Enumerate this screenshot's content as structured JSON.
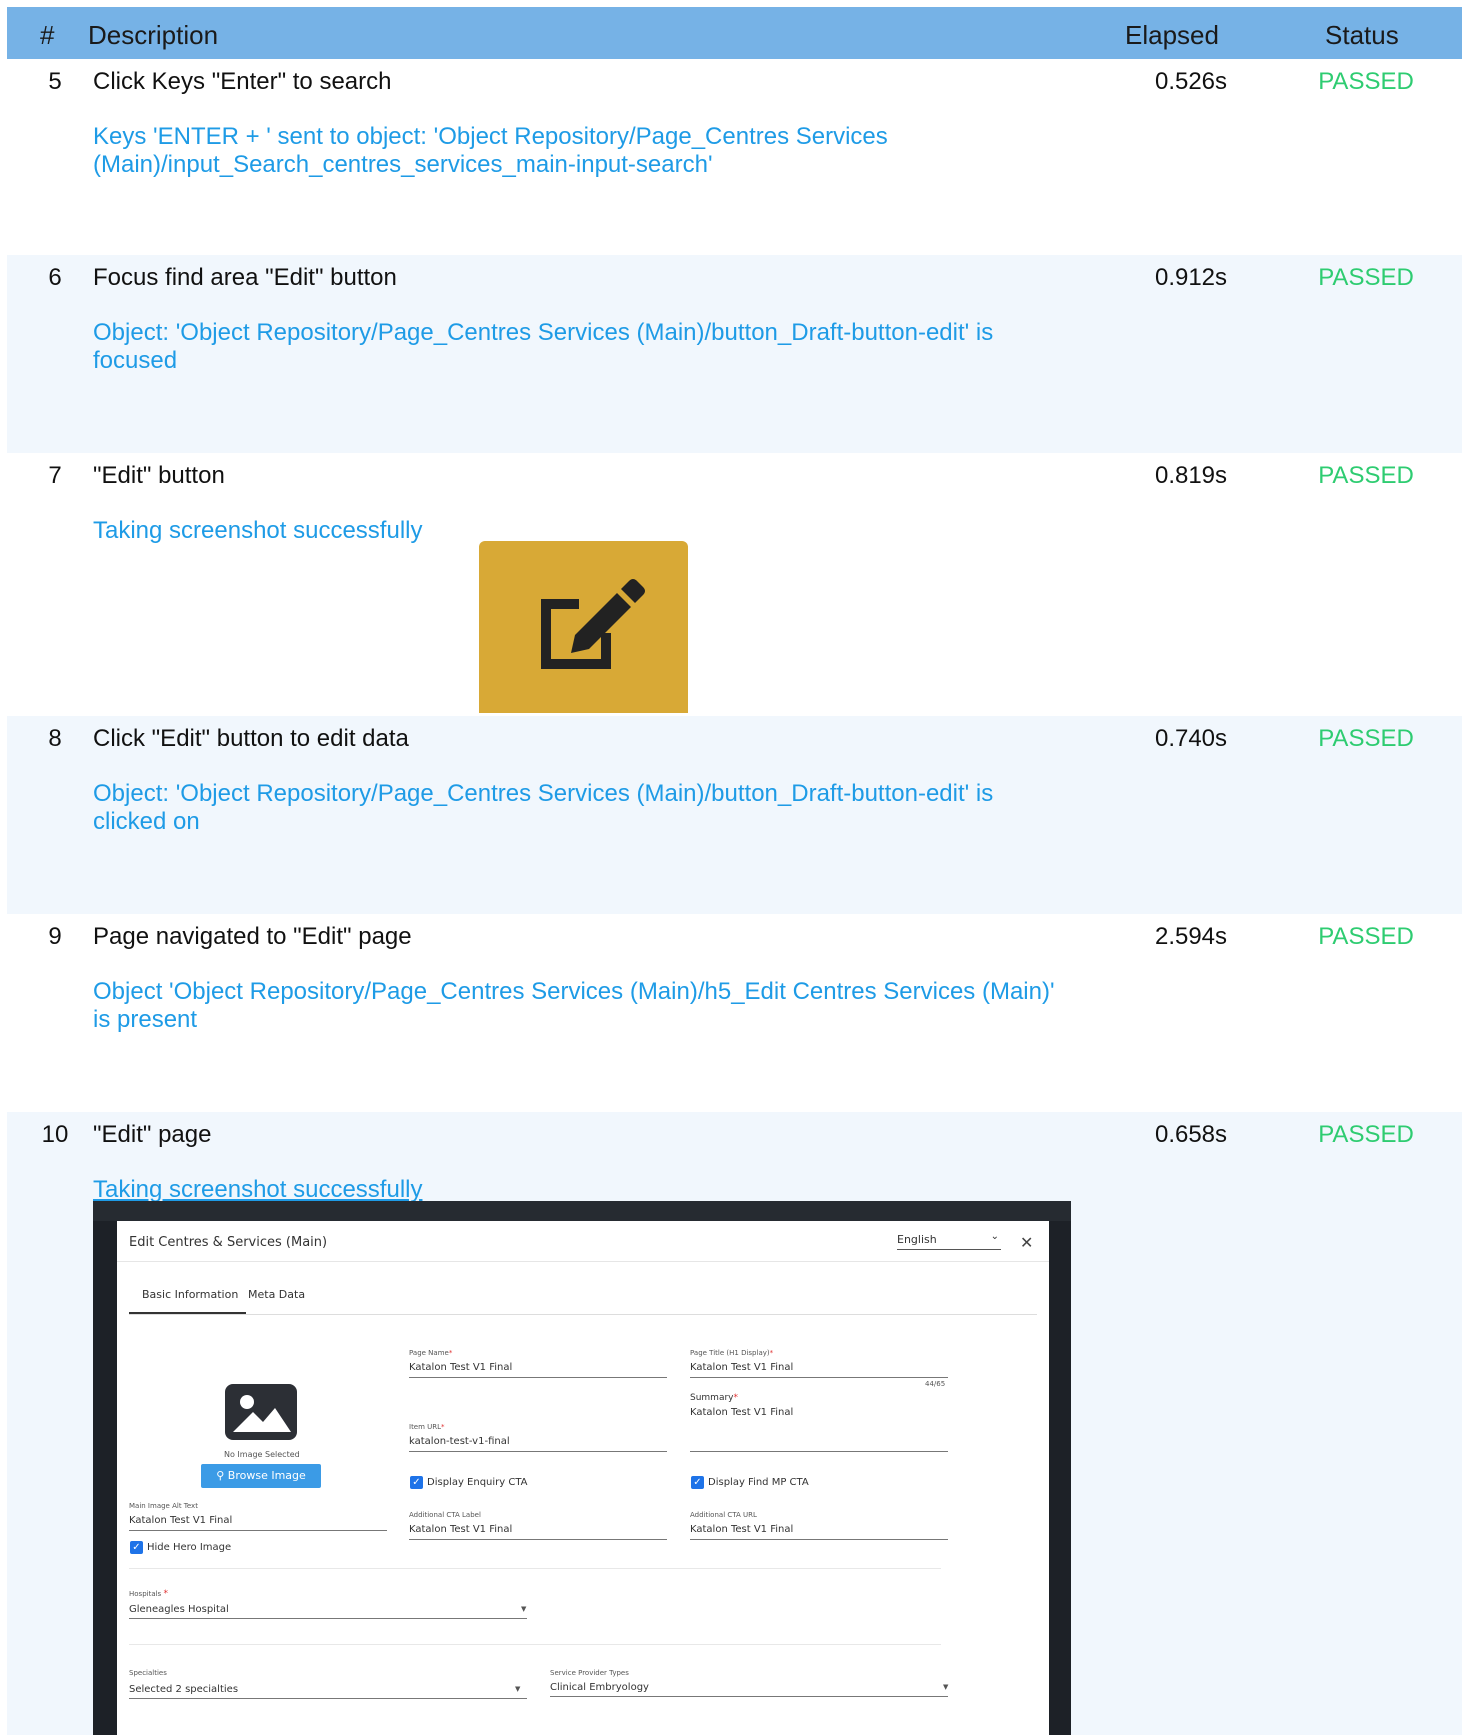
{
  "header": {
    "num": "#",
    "description": "Description",
    "elapsed": "Elapsed",
    "status": "Status"
  },
  "steps": [
    {
      "num": "5",
      "description": "Click Keys \"Enter\" to search",
      "elapsed": "0.526s",
      "status": "PASSED",
      "message_lines": [
        "Keys 'ENTER + ' sent to object: 'Object Repository/Page_Centres  Services",
        "(Main)/input_Search_centres_services_main-input-search'"
      ]
    },
    {
      "num": "6",
      "description": "Focus find area \"Edit\" button",
      "elapsed": "0.912s",
      "status": "PASSED",
      "message_lines": [
        "Object: 'Object Repository/Page_Centres  Services (Main)/button_Draft-button-edit' is",
        "focused"
      ]
    },
    {
      "num": "7",
      "description": "\"Edit\" button",
      "elapsed": "0.819s",
      "status": "PASSED",
      "message_lines": [
        "Taking screenshot successfully"
      ]
    },
    {
      "num": "8",
      "description": "Click \"Edit\" button to edit data",
      "elapsed": "0.740s",
      "status": "PASSED",
      "message_lines": [
        "Object: 'Object Repository/Page_Centres  Services (Main)/button_Draft-button-edit' is",
        "clicked on"
      ]
    },
    {
      "num": "9",
      "description": "Page navigated to \"Edit\" page",
      "elapsed": "2.594s",
      "status": "PASSED",
      "message_lines": [
        "Object 'Object Repository/Page_Centres  Services (Main)/h5_Edit Centres  Services (Main)'",
        "is present"
      ]
    },
    {
      "num": "10",
      "description": "\"Edit\" page",
      "elapsed": "0.658s",
      "status": "PASSED",
      "message_lines": [
        "Taking screenshot successfully"
      ]
    }
  ],
  "edit_screenshot": {
    "title": "Edit Centres & Services (Main)",
    "language": "English",
    "close_glyph": "✕",
    "tabs": [
      "Basic Information",
      "Meta Data"
    ],
    "no_image_text": "No Image Selected",
    "browse_label": "Browse Image",
    "main_image_alt": {
      "label": "Main Image Alt Text",
      "value": "Katalon Test V1 Final"
    },
    "page_name": {
      "label": "Page Name",
      "value": "Katalon Test V1 Final"
    },
    "item_url": {
      "label": "Item URL",
      "value": "katalon-test-v1-final"
    },
    "page_title": {
      "label": "Page Title (H1 Display)",
      "value": "Katalon Test V1 Final",
      "counter": "44/65"
    },
    "summary": {
      "label": "Summary",
      "value": "Katalon Test V1 Final"
    },
    "display_enquiry_cta": {
      "label": "Display Enquiry CTA",
      "checked": true
    },
    "display_find_mp_cta": {
      "label": "Display Find MP CTA",
      "checked": true
    },
    "additional_cta_label": {
      "label": "Additional CTA Label",
      "value": "Katalon Test V1 Final"
    },
    "additional_cta_url": {
      "label": "Additional CTA URL",
      "value": "Katalon Test V1 Final"
    },
    "hide_hero_image": {
      "label": "Hide Hero Image",
      "checked": true
    },
    "hospitals": {
      "label": "Hospitals",
      "value": "Gleneagles Hospital"
    },
    "specialties": {
      "label": "Specialties",
      "value": "Selected 2 specialties"
    },
    "service_provider_types": {
      "label": "Service Provider Types",
      "value": "Clinical Embryology"
    }
  },
  "colors": {
    "header_bg": "#76b2e6",
    "passed": "#2ecc71",
    "message": "#1e9be6",
    "alt_row": "#f1f7fd",
    "edit_button": "#d8a936"
  },
  "icons": [
    "edit-icon",
    "image-placeholder-icon",
    "search-icon",
    "checkbox-icon",
    "close-icon",
    "chevron-down-icon",
    "caret-down-icon"
  ]
}
